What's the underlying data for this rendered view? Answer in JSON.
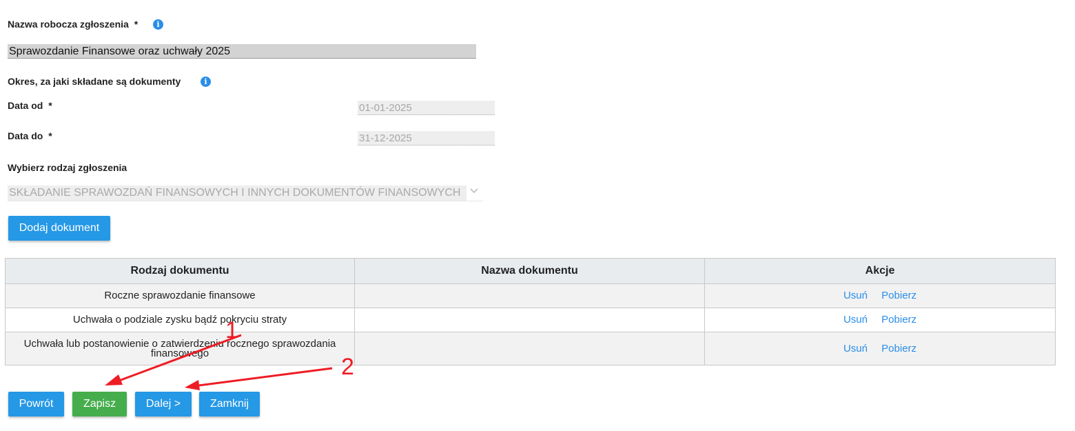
{
  "form": {
    "name_label": "Nazwa robocza zgłoszenia",
    "required_mark": "*",
    "name_value": "Sprawozdanie Finansowe oraz uchwały 2025",
    "period_label": "Okres, za jaki składane są dokumenty",
    "date_from_label": "Data od",
    "date_from_value": "01-01-2025",
    "date_to_label": "Data do",
    "date_to_value": "31-12-2025",
    "type_label": "Wybierz rodzaj zgłoszenia",
    "type_value": "SKŁADANIE SPRAWOZDAŃ FINANSOWYCH I INNYCH DOKUMENTÓW FINANSOWYCH",
    "info_glyph": "i"
  },
  "add_document_label": "Dodaj dokument",
  "table": {
    "headers": [
      "Rodzaj dokumentu",
      "Nazwa dokumentu",
      "Akcje"
    ],
    "rows": [
      {
        "type": "Roczne sprawozdanie finansowe",
        "name": "",
        "delete": "Usuń",
        "download": "Pobierz"
      },
      {
        "type": "Uchwała o podziale zysku bądź pokryciu straty",
        "name": "",
        "delete": "Usuń",
        "download": "Pobierz"
      },
      {
        "type": "Uchwała lub postanowienie o zatwierdzeniu rocznego sprawozdania finansowego",
        "name": "",
        "delete": "Usuń",
        "download": "Pobierz"
      }
    ]
  },
  "buttons": {
    "back": "Powrót",
    "save": "Zapisz",
    "next": "Dalej >",
    "close": "Zamknij"
  },
  "annotations": {
    "marker_1": "1",
    "marker_2": "2",
    "color": "#ee1c24"
  },
  "colors": {
    "accent_blue": "#2598e6",
    "save_green": "#45ad4c"
  }
}
